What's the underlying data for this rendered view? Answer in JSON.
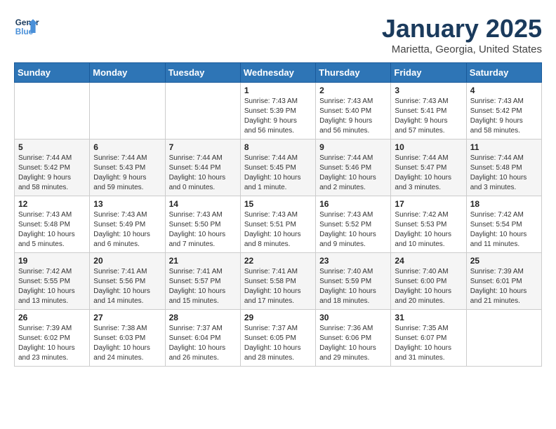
{
  "header": {
    "logo_line1": "General",
    "logo_line2": "Blue",
    "month": "January 2025",
    "location": "Marietta, Georgia, United States"
  },
  "weekdays": [
    "Sunday",
    "Monday",
    "Tuesday",
    "Wednesday",
    "Thursday",
    "Friday",
    "Saturday"
  ],
  "weeks": [
    [
      {
        "day": "",
        "info": ""
      },
      {
        "day": "",
        "info": ""
      },
      {
        "day": "",
        "info": ""
      },
      {
        "day": "1",
        "info": "Sunrise: 7:43 AM\nSunset: 5:39 PM\nDaylight: 9 hours\nand 56 minutes."
      },
      {
        "day": "2",
        "info": "Sunrise: 7:43 AM\nSunset: 5:40 PM\nDaylight: 9 hours\nand 56 minutes."
      },
      {
        "day": "3",
        "info": "Sunrise: 7:43 AM\nSunset: 5:41 PM\nDaylight: 9 hours\nand 57 minutes."
      },
      {
        "day": "4",
        "info": "Sunrise: 7:43 AM\nSunset: 5:42 PM\nDaylight: 9 hours\nand 58 minutes."
      }
    ],
    [
      {
        "day": "5",
        "info": "Sunrise: 7:44 AM\nSunset: 5:42 PM\nDaylight: 9 hours\nand 58 minutes."
      },
      {
        "day": "6",
        "info": "Sunrise: 7:44 AM\nSunset: 5:43 PM\nDaylight: 9 hours\nand 59 minutes."
      },
      {
        "day": "7",
        "info": "Sunrise: 7:44 AM\nSunset: 5:44 PM\nDaylight: 10 hours\nand 0 minutes."
      },
      {
        "day": "8",
        "info": "Sunrise: 7:44 AM\nSunset: 5:45 PM\nDaylight: 10 hours\nand 1 minute."
      },
      {
        "day": "9",
        "info": "Sunrise: 7:44 AM\nSunset: 5:46 PM\nDaylight: 10 hours\nand 2 minutes."
      },
      {
        "day": "10",
        "info": "Sunrise: 7:44 AM\nSunset: 5:47 PM\nDaylight: 10 hours\nand 3 minutes."
      },
      {
        "day": "11",
        "info": "Sunrise: 7:44 AM\nSunset: 5:48 PM\nDaylight: 10 hours\nand 3 minutes."
      }
    ],
    [
      {
        "day": "12",
        "info": "Sunrise: 7:43 AM\nSunset: 5:48 PM\nDaylight: 10 hours\nand 5 minutes."
      },
      {
        "day": "13",
        "info": "Sunrise: 7:43 AM\nSunset: 5:49 PM\nDaylight: 10 hours\nand 6 minutes."
      },
      {
        "day": "14",
        "info": "Sunrise: 7:43 AM\nSunset: 5:50 PM\nDaylight: 10 hours\nand 7 minutes."
      },
      {
        "day": "15",
        "info": "Sunrise: 7:43 AM\nSunset: 5:51 PM\nDaylight: 10 hours\nand 8 minutes."
      },
      {
        "day": "16",
        "info": "Sunrise: 7:43 AM\nSunset: 5:52 PM\nDaylight: 10 hours\nand 9 minutes."
      },
      {
        "day": "17",
        "info": "Sunrise: 7:42 AM\nSunset: 5:53 PM\nDaylight: 10 hours\nand 10 minutes."
      },
      {
        "day": "18",
        "info": "Sunrise: 7:42 AM\nSunset: 5:54 PM\nDaylight: 10 hours\nand 11 minutes."
      }
    ],
    [
      {
        "day": "19",
        "info": "Sunrise: 7:42 AM\nSunset: 5:55 PM\nDaylight: 10 hours\nand 13 minutes."
      },
      {
        "day": "20",
        "info": "Sunrise: 7:41 AM\nSunset: 5:56 PM\nDaylight: 10 hours\nand 14 minutes."
      },
      {
        "day": "21",
        "info": "Sunrise: 7:41 AM\nSunset: 5:57 PM\nDaylight: 10 hours\nand 15 minutes."
      },
      {
        "day": "22",
        "info": "Sunrise: 7:41 AM\nSunset: 5:58 PM\nDaylight: 10 hours\nand 17 minutes."
      },
      {
        "day": "23",
        "info": "Sunrise: 7:40 AM\nSunset: 5:59 PM\nDaylight: 10 hours\nand 18 minutes."
      },
      {
        "day": "24",
        "info": "Sunrise: 7:40 AM\nSunset: 6:00 PM\nDaylight: 10 hours\nand 20 minutes."
      },
      {
        "day": "25",
        "info": "Sunrise: 7:39 AM\nSunset: 6:01 PM\nDaylight: 10 hours\nand 21 minutes."
      }
    ],
    [
      {
        "day": "26",
        "info": "Sunrise: 7:39 AM\nSunset: 6:02 PM\nDaylight: 10 hours\nand 23 minutes."
      },
      {
        "day": "27",
        "info": "Sunrise: 7:38 AM\nSunset: 6:03 PM\nDaylight: 10 hours\nand 24 minutes."
      },
      {
        "day": "28",
        "info": "Sunrise: 7:37 AM\nSunset: 6:04 PM\nDaylight: 10 hours\nand 26 minutes."
      },
      {
        "day": "29",
        "info": "Sunrise: 7:37 AM\nSunset: 6:05 PM\nDaylight: 10 hours\nand 28 minutes."
      },
      {
        "day": "30",
        "info": "Sunrise: 7:36 AM\nSunset: 6:06 PM\nDaylight: 10 hours\nand 29 minutes."
      },
      {
        "day": "31",
        "info": "Sunrise: 7:35 AM\nSunset: 6:07 PM\nDaylight: 10 hours\nand 31 minutes."
      },
      {
        "day": "",
        "info": ""
      }
    ]
  ]
}
